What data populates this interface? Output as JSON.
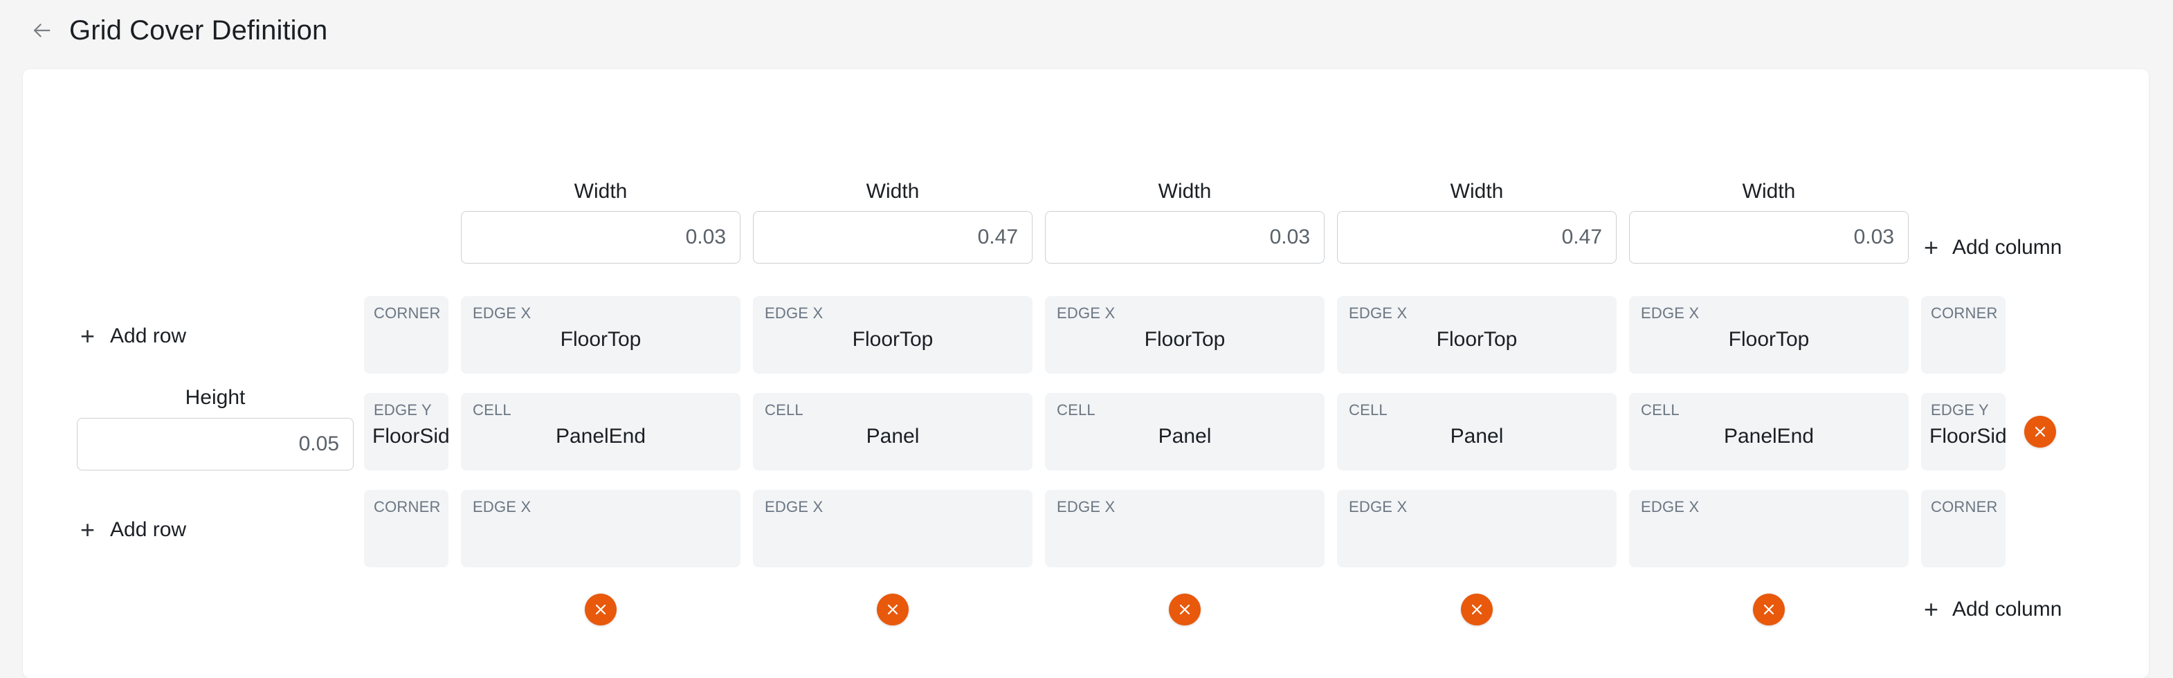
{
  "header": {
    "back_icon": "arrow-left-icon",
    "title": "Grid Cover Definition"
  },
  "controls": {
    "add_row_label": "Add row",
    "add_column_label": "Add column",
    "plus_icon": "plus-icon",
    "delete_icon": "close-x-icon",
    "accent_color": "#e8590c",
    "cell_bg_color": "#f2f4f6",
    "kind_text_color": "#6b7682"
  },
  "height": {
    "label": "Height",
    "value": "0.05",
    "placeholder": ""
  },
  "columns": [
    {
      "width_label": "Width",
      "width_value": "0.03"
    },
    {
      "width_label": "Width",
      "width_value": "0.47"
    },
    {
      "width_label": "Width",
      "width_value": "0.03"
    },
    {
      "width_label": "Width",
      "width_value": "0.47"
    },
    {
      "width_label": "Width",
      "width_value": "0.03"
    }
  ],
  "grid": {
    "rows": [
      {
        "left": {
          "kind": "CORNER",
          "value": ""
        },
        "cells": [
          {
            "kind": "EDGE X",
            "value": "FloorTop"
          },
          {
            "kind": "EDGE X",
            "value": "FloorTop"
          },
          {
            "kind": "EDGE X",
            "value": "FloorTop"
          },
          {
            "kind": "EDGE X",
            "value": "FloorTop"
          },
          {
            "kind": "EDGE X",
            "value": "FloorTop"
          }
        ],
        "right": {
          "kind": "CORNER",
          "value": ""
        },
        "has_delete": false
      },
      {
        "left": {
          "kind": "EDGE Y",
          "value": "FloorSide"
        },
        "cells": [
          {
            "kind": "CELL",
            "value": "PanelEnd"
          },
          {
            "kind": "CELL",
            "value": "Panel"
          },
          {
            "kind": "CELL",
            "value": "Panel"
          },
          {
            "kind": "CELL",
            "value": "Panel"
          },
          {
            "kind": "CELL",
            "value": "PanelEnd"
          }
        ],
        "right": {
          "kind": "EDGE Y",
          "value": "FloorSide"
        },
        "has_delete": true
      },
      {
        "left": {
          "kind": "CORNER",
          "value": ""
        },
        "cells": [
          {
            "kind": "EDGE X",
            "value": ""
          },
          {
            "kind": "EDGE X",
            "value": ""
          },
          {
            "kind": "EDGE X",
            "value": ""
          },
          {
            "kind": "EDGE X",
            "value": ""
          },
          {
            "kind": "EDGE X",
            "value": ""
          }
        ],
        "right": {
          "kind": "CORNER",
          "value": ""
        },
        "has_delete": false
      }
    ]
  }
}
